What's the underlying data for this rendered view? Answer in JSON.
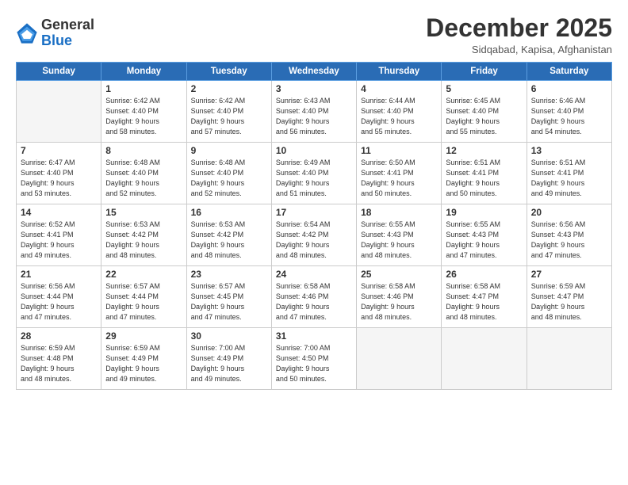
{
  "header": {
    "logo_general": "General",
    "logo_blue": "Blue",
    "month_title": "December 2025",
    "location": "Sidqabad, Kapisa, Afghanistan"
  },
  "weekdays": [
    "Sunday",
    "Monday",
    "Tuesday",
    "Wednesday",
    "Thursday",
    "Friday",
    "Saturday"
  ],
  "weeks": [
    [
      {
        "day": null,
        "info": null
      },
      {
        "day": "1",
        "info": "Sunrise: 6:42 AM\nSunset: 4:40 PM\nDaylight: 9 hours\nand 58 minutes."
      },
      {
        "day": "2",
        "info": "Sunrise: 6:42 AM\nSunset: 4:40 PM\nDaylight: 9 hours\nand 57 minutes."
      },
      {
        "day": "3",
        "info": "Sunrise: 6:43 AM\nSunset: 4:40 PM\nDaylight: 9 hours\nand 56 minutes."
      },
      {
        "day": "4",
        "info": "Sunrise: 6:44 AM\nSunset: 4:40 PM\nDaylight: 9 hours\nand 55 minutes."
      },
      {
        "day": "5",
        "info": "Sunrise: 6:45 AM\nSunset: 4:40 PM\nDaylight: 9 hours\nand 55 minutes."
      },
      {
        "day": "6",
        "info": "Sunrise: 6:46 AM\nSunset: 4:40 PM\nDaylight: 9 hours\nand 54 minutes."
      }
    ],
    [
      {
        "day": "7",
        "info": "Sunrise: 6:47 AM\nSunset: 4:40 PM\nDaylight: 9 hours\nand 53 minutes."
      },
      {
        "day": "8",
        "info": "Sunrise: 6:48 AM\nSunset: 4:40 PM\nDaylight: 9 hours\nand 52 minutes."
      },
      {
        "day": "9",
        "info": "Sunrise: 6:48 AM\nSunset: 4:40 PM\nDaylight: 9 hours\nand 52 minutes."
      },
      {
        "day": "10",
        "info": "Sunrise: 6:49 AM\nSunset: 4:40 PM\nDaylight: 9 hours\nand 51 minutes."
      },
      {
        "day": "11",
        "info": "Sunrise: 6:50 AM\nSunset: 4:41 PM\nDaylight: 9 hours\nand 50 minutes."
      },
      {
        "day": "12",
        "info": "Sunrise: 6:51 AM\nSunset: 4:41 PM\nDaylight: 9 hours\nand 50 minutes."
      },
      {
        "day": "13",
        "info": "Sunrise: 6:51 AM\nSunset: 4:41 PM\nDaylight: 9 hours\nand 49 minutes."
      }
    ],
    [
      {
        "day": "14",
        "info": "Sunrise: 6:52 AM\nSunset: 4:41 PM\nDaylight: 9 hours\nand 49 minutes."
      },
      {
        "day": "15",
        "info": "Sunrise: 6:53 AM\nSunset: 4:42 PM\nDaylight: 9 hours\nand 48 minutes."
      },
      {
        "day": "16",
        "info": "Sunrise: 6:53 AM\nSunset: 4:42 PM\nDaylight: 9 hours\nand 48 minutes."
      },
      {
        "day": "17",
        "info": "Sunrise: 6:54 AM\nSunset: 4:42 PM\nDaylight: 9 hours\nand 48 minutes."
      },
      {
        "day": "18",
        "info": "Sunrise: 6:55 AM\nSunset: 4:43 PM\nDaylight: 9 hours\nand 48 minutes."
      },
      {
        "day": "19",
        "info": "Sunrise: 6:55 AM\nSunset: 4:43 PM\nDaylight: 9 hours\nand 47 minutes."
      },
      {
        "day": "20",
        "info": "Sunrise: 6:56 AM\nSunset: 4:43 PM\nDaylight: 9 hours\nand 47 minutes."
      }
    ],
    [
      {
        "day": "21",
        "info": "Sunrise: 6:56 AM\nSunset: 4:44 PM\nDaylight: 9 hours\nand 47 minutes."
      },
      {
        "day": "22",
        "info": "Sunrise: 6:57 AM\nSunset: 4:44 PM\nDaylight: 9 hours\nand 47 minutes."
      },
      {
        "day": "23",
        "info": "Sunrise: 6:57 AM\nSunset: 4:45 PM\nDaylight: 9 hours\nand 47 minutes."
      },
      {
        "day": "24",
        "info": "Sunrise: 6:58 AM\nSunset: 4:46 PM\nDaylight: 9 hours\nand 47 minutes."
      },
      {
        "day": "25",
        "info": "Sunrise: 6:58 AM\nSunset: 4:46 PM\nDaylight: 9 hours\nand 48 minutes."
      },
      {
        "day": "26",
        "info": "Sunrise: 6:58 AM\nSunset: 4:47 PM\nDaylight: 9 hours\nand 48 minutes."
      },
      {
        "day": "27",
        "info": "Sunrise: 6:59 AM\nSunset: 4:47 PM\nDaylight: 9 hours\nand 48 minutes."
      }
    ],
    [
      {
        "day": "28",
        "info": "Sunrise: 6:59 AM\nSunset: 4:48 PM\nDaylight: 9 hours\nand 48 minutes."
      },
      {
        "day": "29",
        "info": "Sunrise: 6:59 AM\nSunset: 4:49 PM\nDaylight: 9 hours\nand 49 minutes."
      },
      {
        "day": "30",
        "info": "Sunrise: 7:00 AM\nSunset: 4:49 PM\nDaylight: 9 hours\nand 49 minutes."
      },
      {
        "day": "31",
        "info": "Sunrise: 7:00 AM\nSunset: 4:50 PM\nDaylight: 9 hours\nand 50 minutes."
      },
      {
        "day": null,
        "info": null
      },
      {
        "day": null,
        "info": null
      },
      {
        "day": null,
        "info": null
      }
    ]
  ]
}
